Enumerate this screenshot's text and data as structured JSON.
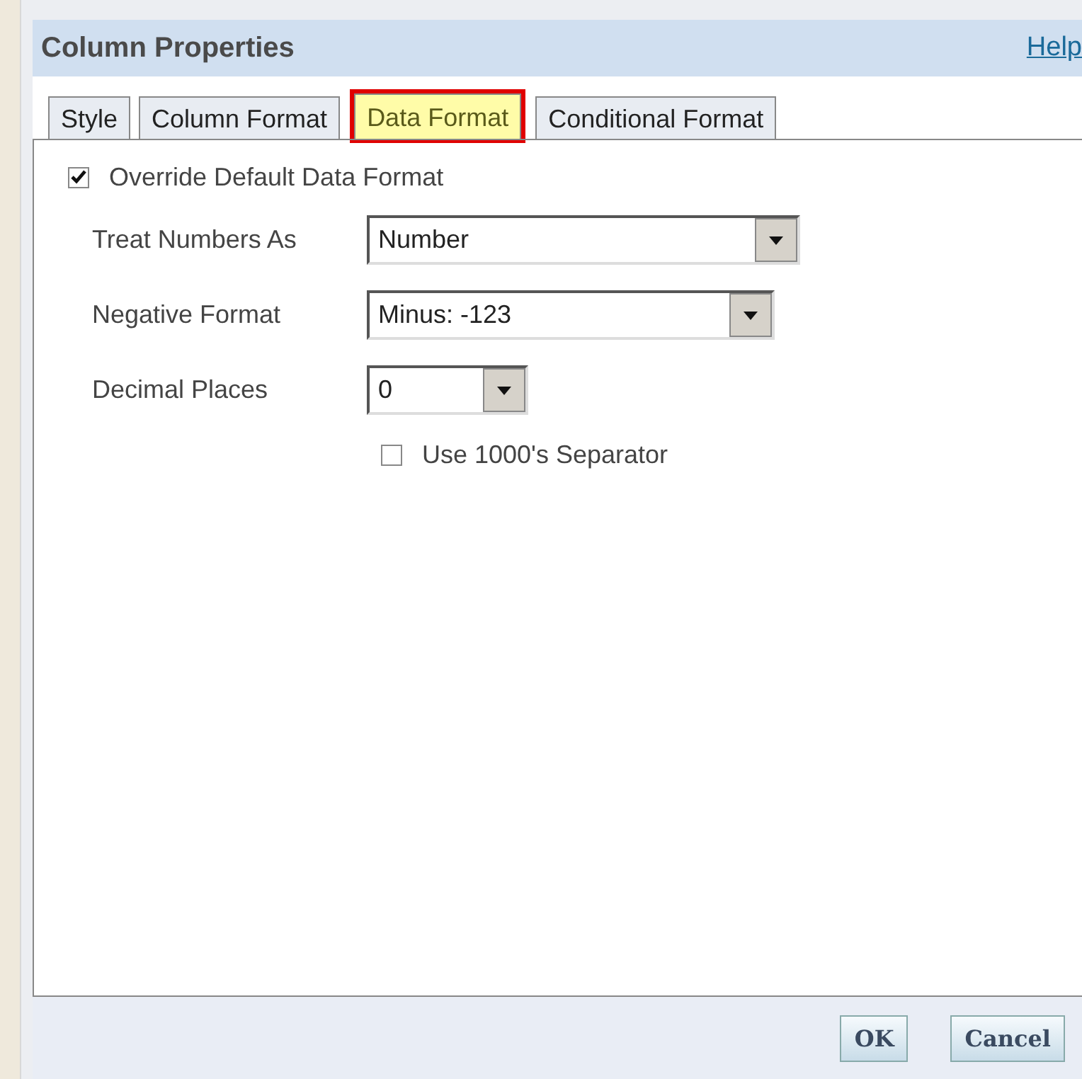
{
  "dialog": {
    "title": "Column Properties",
    "help_link": "Help"
  },
  "tabs": [
    {
      "label": "Style",
      "selected": false,
      "annotated": false
    },
    {
      "label": "Column Format",
      "selected": false,
      "annotated": false
    },
    {
      "label": "Data Format",
      "selected": true,
      "annotated": true
    },
    {
      "label": "Conditional Format",
      "selected": false,
      "annotated": false
    }
  ],
  "override": {
    "label": "Override Default Data Format",
    "checked": true
  },
  "fields": [
    {
      "label": "Treat Numbers As",
      "value": "Number"
    },
    {
      "label": "Negative Format",
      "value": "Minus: -123"
    },
    {
      "label": "Decimal Places",
      "value": "0"
    }
  ],
  "separator": {
    "label": "Use 1000's Separator",
    "checked": false
  },
  "buttons": [
    "OK",
    "Cancel"
  ]
}
